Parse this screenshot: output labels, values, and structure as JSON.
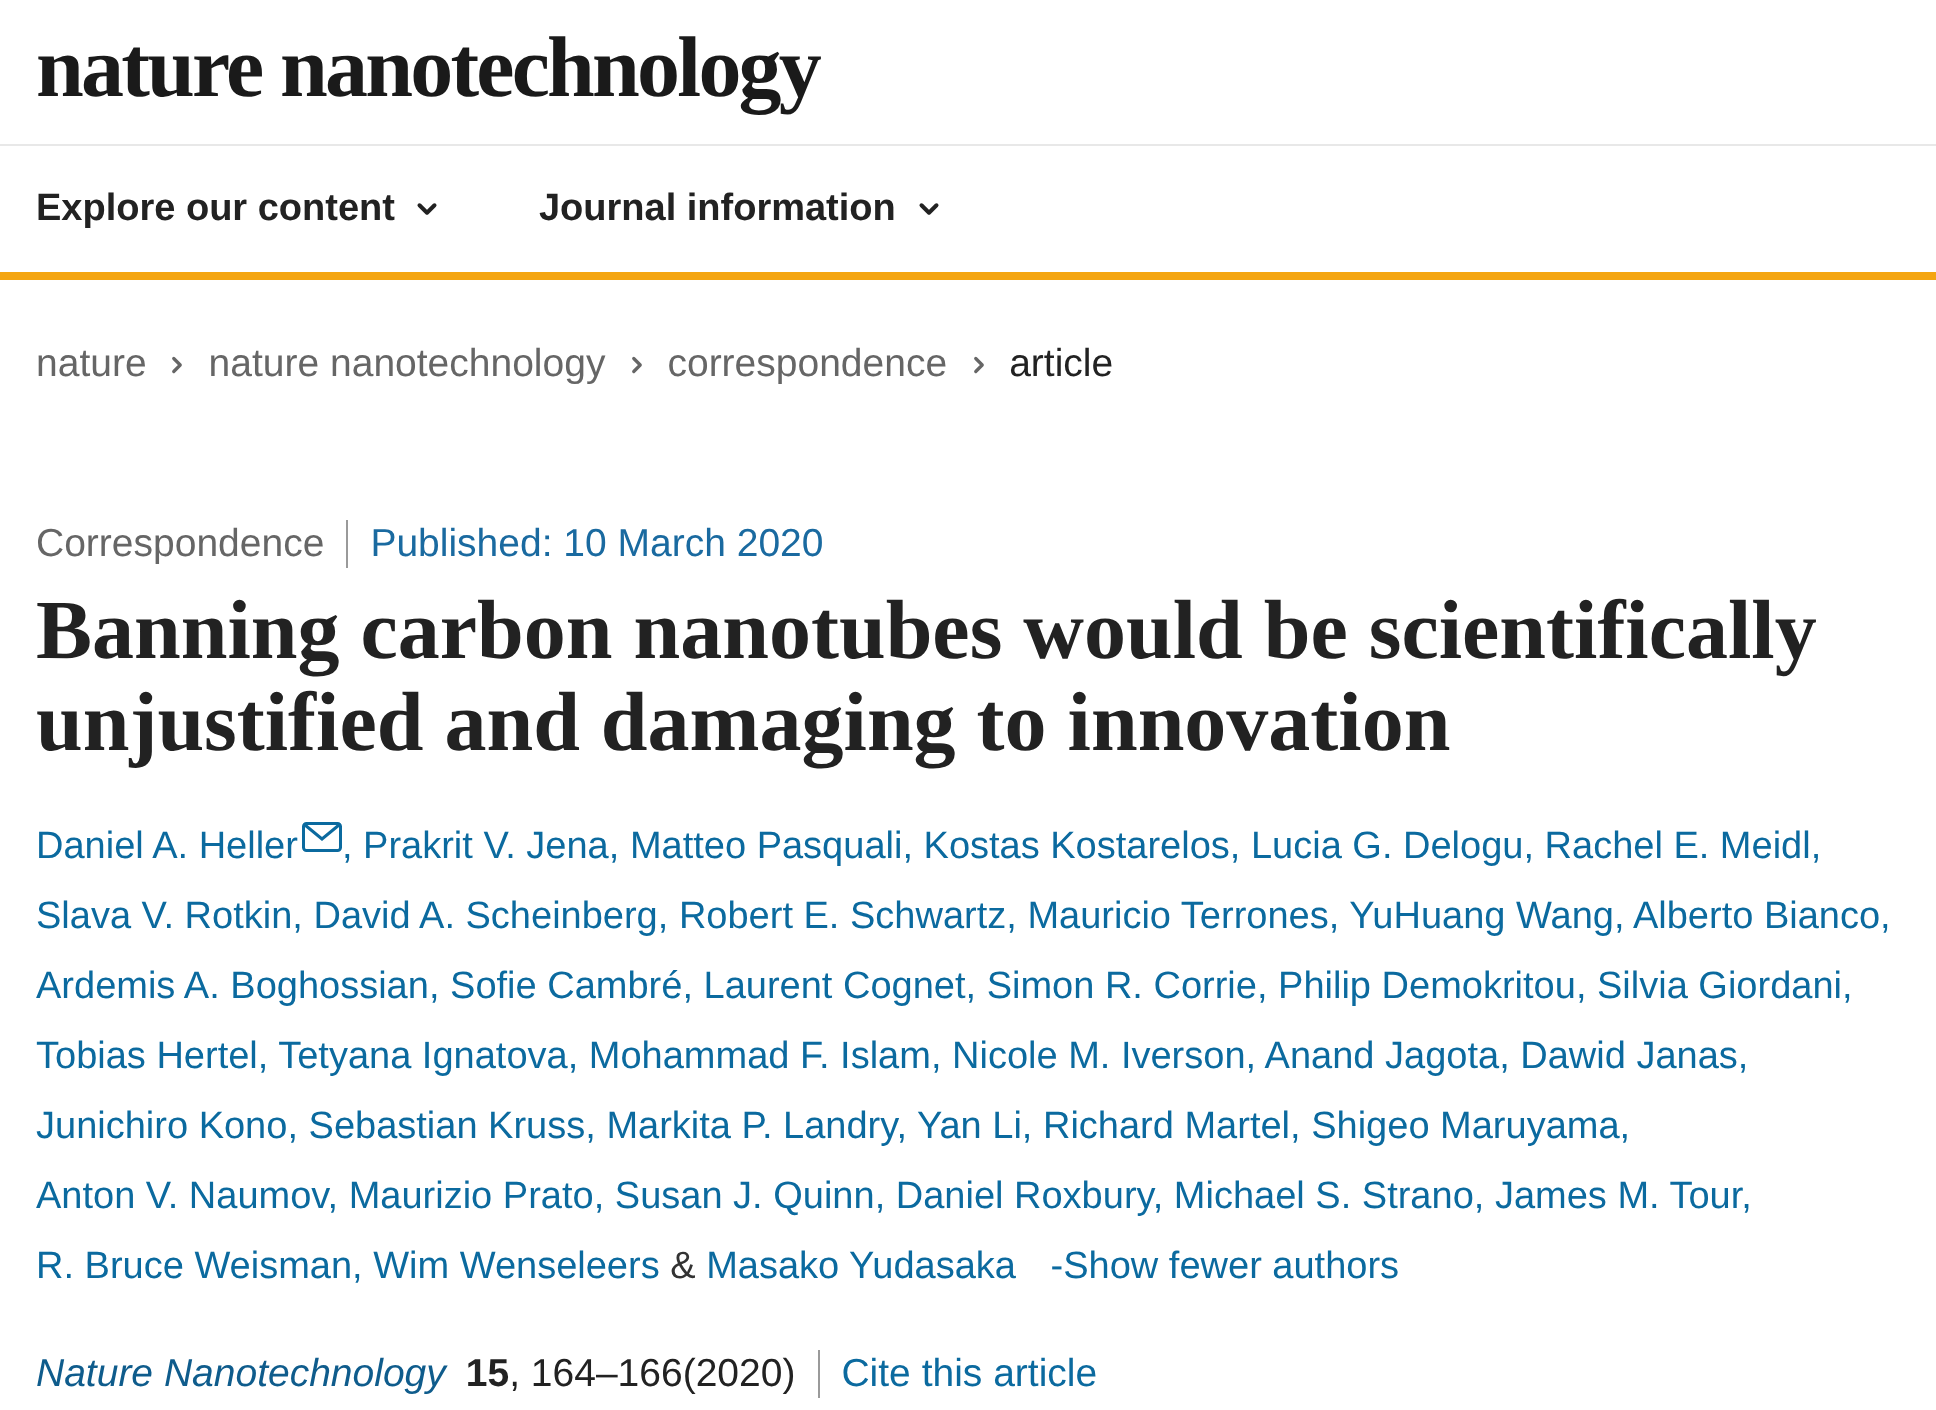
{
  "header": {
    "logo": "nature nanotechnology"
  },
  "nav": [
    {
      "label": "Explore our content",
      "expanded": false
    },
    {
      "label": "Journal information",
      "expanded": false
    }
  ],
  "breadcrumb": [
    {
      "label": "nature",
      "current": false
    },
    {
      "label": "nature nanotechnology",
      "current": false
    },
    {
      "label": "correspondence",
      "current": false
    },
    {
      "label": "article",
      "current": true
    }
  ],
  "article": {
    "type": "Correspondence",
    "published": "Published: 10 March 2020",
    "title": "Banning carbon nanotubes would be scientifically unjustified and damaging to innovation",
    "authors": [
      {
        "name": "Daniel A. Heller",
        "corresponding": true,
        "separator": ","
      },
      {
        "name": "Prakrit V. Jena",
        "corresponding": false,
        "separator": ","
      },
      {
        "name": "Matteo Pasquali",
        "corresponding": false,
        "separator": ","
      },
      {
        "name": "Kostas Kostarelos",
        "corresponding": false,
        "separator": ","
      },
      {
        "name": "Lucia G. Delogu",
        "corresponding": false,
        "separator": ","
      },
      {
        "name": "Rachel E. Meidl",
        "corresponding": false,
        "separator": ","
      },
      {
        "name": "Slava V. Rotkin",
        "corresponding": false,
        "separator": ","
      },
      {
        "name": "David A. Scheinberg",
        "corresponding": false,
        "separator": ","
      },
      {
        "name": "Robert E. Schwartz",
        "corresponding": false,
        "separator": ","
      },
      {
        "name": "Mauricio Terrones",
        "corresponding": false,
        "separator": ","
      },
      {
        "name": "YuHuang Wang",
        "corresponding": false,
        "separator": ","
      },
      {
        "name": "Alberto Bianco",
        "corresponding": false,
        "separator": ","
      },
      {
        "name": "Ardemis A. Boghossian",
        "corresponding": false,
        "separator": ","
      },
      {
        "name": "Sofie Cambré",
        "corresponding": false,
        "separator": ","
      },
      {
        "name": "Laurent Cognet",
        "corresponding": false,
        "separator": ","
      },
      {
        "name": "Simon R. Corrie",
        "corresponding": false,
        "separator": ","
      },
      {
        "name": "Philip Demokritou",
        "corresponding": false,
        "separator": ","
      },
      {
        "name": "Silvia Giordani",
        "corresponding": false,
        "separator": ","
      },
      {
        "name": "Tobias Hertel",
        "corresponding": false,
        "separator": ","
      },
      {
        "name": "Tetyana Ignatova",
        "corresponding": false,
        "separator": ","
      },
      {
        "name": "Mohammad F. Islam",
        "corresponding": false,
        "separator": ","
      },
      {
        "name": "Nicole M. Iverson",
        "corresponding": false,
        "separator": ","
      },
      {
        "name": "Anand Jagota",
        "corresponding": false,
        "separator": ","
      },
      {
        "name": "Dawid Janas",
        "corresponding": false,
        "separator": ","
      },
      {
        "name": "Junichiro Kono",
        "corresponding": false,
        "separator": ","
      },
      {
        "name": "Sebastian Kruss",
        "corresponding": false,
        "separator": ","
      },
      {
        "name": "Markita P. Landry",
        "corresponding": false,
        "separator": ","
      },
      {
        "name": "Yan Li",
        "corresponding": false,
        "separator": ","
      },
      {
        "name": "Richard Martel",
        "corresponding": false,
        "separator": ","
      },
      {
        "name": "Shigeo Maruyama",
        "corresponding": false,
        "separator": ","
      },
      {
        "name": "Anton V. Naumov",
        "corresponding": false,
        "separator": ","
      },
      {
        "name": "Maurizio Prato",
        "corresponding": false,
        "separator": ","
      },
      {
        "name": "Susan J. Quinn",
        "corresponding": false,
        "separator": ","
      },
      {
        "name": "Daniel Roxbury",
        "corresponding": false,
        "separator": ","
      },
      {
        "name": "Michael S. Strano",
        "corresponding": false,
        "separator": ","
      },
      {
        "name": "James M. Tour",
        "corresponding": false,
        "separator": ","
      },
      {
        "name": "R. Bruce Weisman",
        "corresponding": false,
        "separator": ","
      },
      {
        "name": "Wim Wenseleers",
        "corresponding": false
      },
      {
        "name": "Masako Yudasaka",
        "corresponding": false
      }
    ],
    "author_conjunction": "&",
    "author_toggle": "-Show fewer authors",
    "citation": {
      "journal": "Nature Nanotechnology",
      "volume_pages": "**15**, 164–166(2020)",
      "cite_link": "Cite this article"
    }
  }
}
